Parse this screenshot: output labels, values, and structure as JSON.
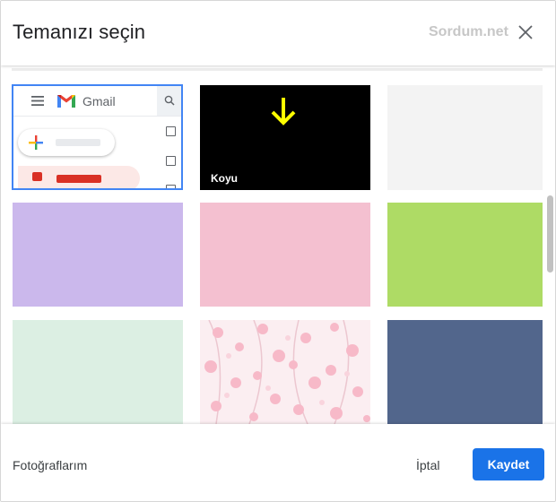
{
  "dialog": {
    "title": "Temanızı seçin",
    "watermark": "Sordum.net",
    "close_icon": "close-icon"
  },
  "themes": {
    "default_preview": {
      "app_name": "Gmail",
      "icons": [
        "menu-icon",
        "gmail-logo-icon",
        "search-icon",
        "compose-plus-icon",
        "inbox-icon"
      ]
    },
    "tiles": [
      {
        "name": "default",
        "color": "#ffffff",
        "selected": true
      },
      {
        "name": "dark",
        "label": "Koyu",
        "color": "#000000",
        "annotation": "yellow-down-arrow"
      },
      {
        "name": "light-gray",
        "color": "#f3f3f3"
      },
      {
        "name": "lavender",
        "color": "#cbb8ec"
      },
      {
        "name": "pink",
        "color": "#f4c0d0"
      },
      {
        "name": "lime",
        "color": "#aedb65"
      },
      {
        "name": "mint",
        "color": "#dcefe3"
      },
      {
        "name": "cherry-blossom",
        "color": "#fbeef1",
        "pattern": "floral"
      },
      {
        "name": "slate-blue",
        "color": "#52668c"
      }
    ]
  },
  "footer": {
    "photos_label": "Fotoğraflarım",
    "cancel_label": "İptal",
    "save_label": "Kaydet"
  },
  "colors": {
    "accent": "#1a73e8",
    "selection_border": "#4285f4",
    "arrow": "#ffff00"
  }
}
